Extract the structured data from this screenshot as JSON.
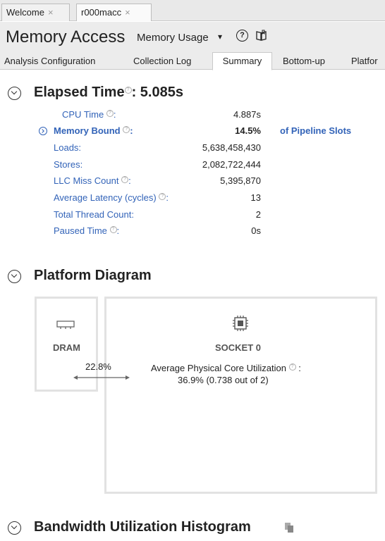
{
  "doc_tabs": [
    {
      "label": "Welcome",
      "close": "×"
    },
    {
      "label": "r000macc",
      "close": "×"
    }
  ],
  "header": {
    "title": "Memory Access",
    "mode": "Memory Usage",
    "caret": "▾",
    "help": "?"
  },
  "analysis_tabs": [
    "Analysis Configuration",
    "Collection Log",
    "Summary",
    "Bottom-up",
    "Platfor"
  ],
  "elapsed": {
    "title": "Elapsed Time",
    "value": ": 5.085s",
    "metrics": [
      {
        "label": "CPU Time",
        "help": true,
        "value": "4.887s"
      },
      {
        "label": "Memory Bound",
        "help": true,
        "value": "14.5%",
        "unit": "of Pipeline Slots"
      },
      {
        "label": "Loads:",
        "value": "5,638,458,430"
      },
      {
        "label": "Stores:",
        "value": "2,082,722,444"
      },
      {
        "label": "LLC Miss Count",
        "help": true,
        "value": "5,395,870"
      },
      {
        "label": "Average Latency (cycles)",
        "help": true,
        "value": "13"
      },
      {
        "label": "Total Thread Count:",
        "value": "2"
      },
      {
        "label": "Paused Time",
        "help": true,
        "value": "0s"
      }
    ]
  },
  "platform": {
    "title": "Platform Diagram",
    "dram_label": "DRAM",
    "socket_label": "SOCKET 0",
    "bandwidth": "22.8%",
    "util_label": "Average Physical Core Utilization",
    "util_value": "36.9% (0.738 out of 2)"
  },
  "bandwidth_hist": {
    "title": "Bandwidth Utilization Histogram"
  },
  "colors": {
    "link": "#3263b8",
    "header_bg": "#ececec",
    "box_border": "#e2e2e2"
  }
}
